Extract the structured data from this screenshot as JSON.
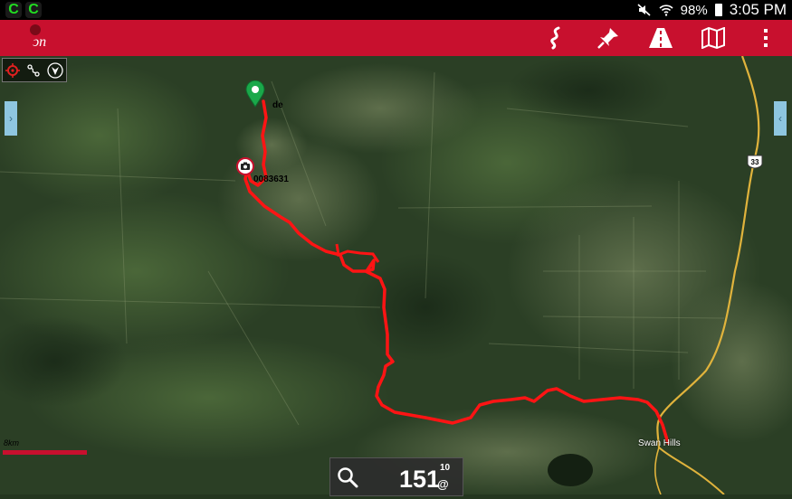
{
  "status_bar": {
    "notifications": [
      "C",
      "C"
    ],
    "battery": "98%",
    "time": "3:05 PM"
  },
  "toolbar": {
    "logo_text": "ↄn",
    "actions": [
      "route-icon",
      "pin-icon",
      "road-icon",
      "map-icon",
      "overflow-menu-icon"
    ]
  },
  "map": {
    "waypoint_label": "de",
    "photo_label": "0083631",
    "highway_shield": "33",
    "town_label": "Swan Hills",
    "scale_label": "8km"
  },
  "controls": {
    "left_tab": "›",
    "right_tab": "‹"
  },
  "speed_panel": {
    "value": "151",
    "superscript": "10",
    "unit": "@"
  },
  "colors": {
    "toolbar": "#c8102e",
    "route": "#ff1414",
    "start_marker": "#1aa84a"
  }
}
